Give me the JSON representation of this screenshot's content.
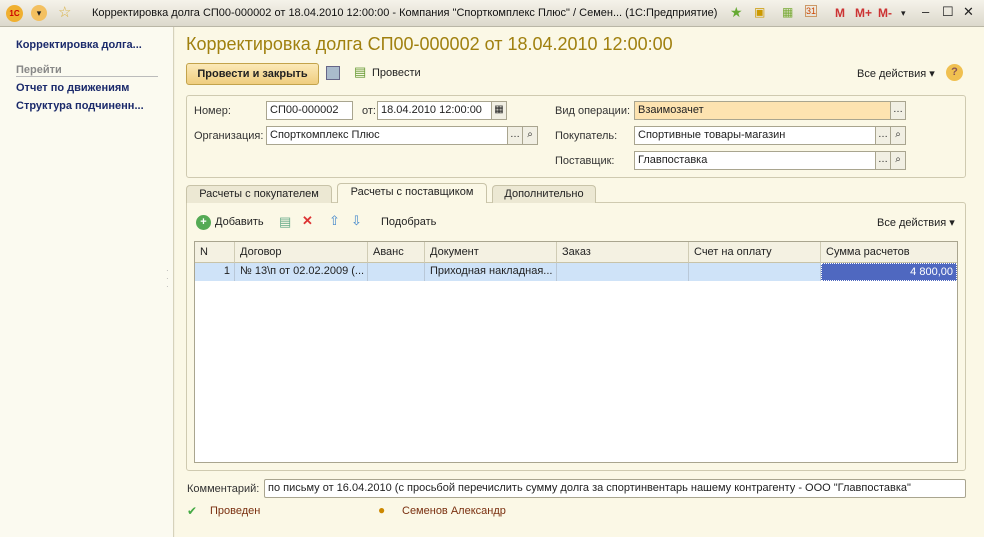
{
  "window": {
    "title": "Корректировка долга СП00-000002 от 18.04.2010 12:00:00 - Компания \"Спорткомплекс Плюс\" / Семен...  (1С:Предприятие)",
    "controls": [
      "M",
      "M+",
      "M-"
    ]
  },
  "sidebar": {
    "current": "Корректировка долга...",
    "section": "Перейти",
    "items": [
      "Отчет по движениям",
      "Структура подчиненн..."
    ]
  },
  "form": {
    "title": "Корректировка долга СП00-000002 от 18.04.2010 12:00:00",
    "toolbar": {
      "post_close": "Провести и закрыть",
      "post": "Провести",
      "all_actions": "Все действия"
    },
    "fields": {
      "number_label": "Номер:",
      "number": "СП00-000002",
      "date_label": "от:",
      "date": "18.04.2010 12:00:00",
      "org_label": "Организация:",
      "org": "Спорткомплекс Плюс",
      "op_label": "Вид операции:",
      "op": "Взаимозачет",
      "buyer_label": "Покупатель:",
      "buyer": "Спортивные товары-магазин",
      "supplier_label": "Поставщик:",
      "supplier": "Главпоставка"
    },
    "tabs": [
      "Расчеты с покупателем",
      "Расчеты с поставщиком",
      "Дополнительно"
    ],
    "table_toolbar": {
      "add": "Добавить",
      "pick": "Подобрать",
      "all_actions": "Все действия"
    },
    "table": {
      "columns": [
        "N",
        "Договор",
        "Аванс",
        "Документ",
        "Заказ",
        "Счет на оплату",
        "Сумма расчетов"
      ],
      "rows": [
        [
          "1",
          "№ 13\\п от 02.02.2009 (...",
          "",
          "Приходная накладная...",
          "",
          "",
          "4 800,00"
        ]
      ]
    },
    "comment_label": "Комментарий:",
    "comment": "по письму от 16.04.2010 (с просьбой перечислить сумму долга за спортинвентарь нашему контрагенту - ООО \"Главпоставка\"",
    "status": "Проведен",
    "author": "Семенов Александр"
  }
}
